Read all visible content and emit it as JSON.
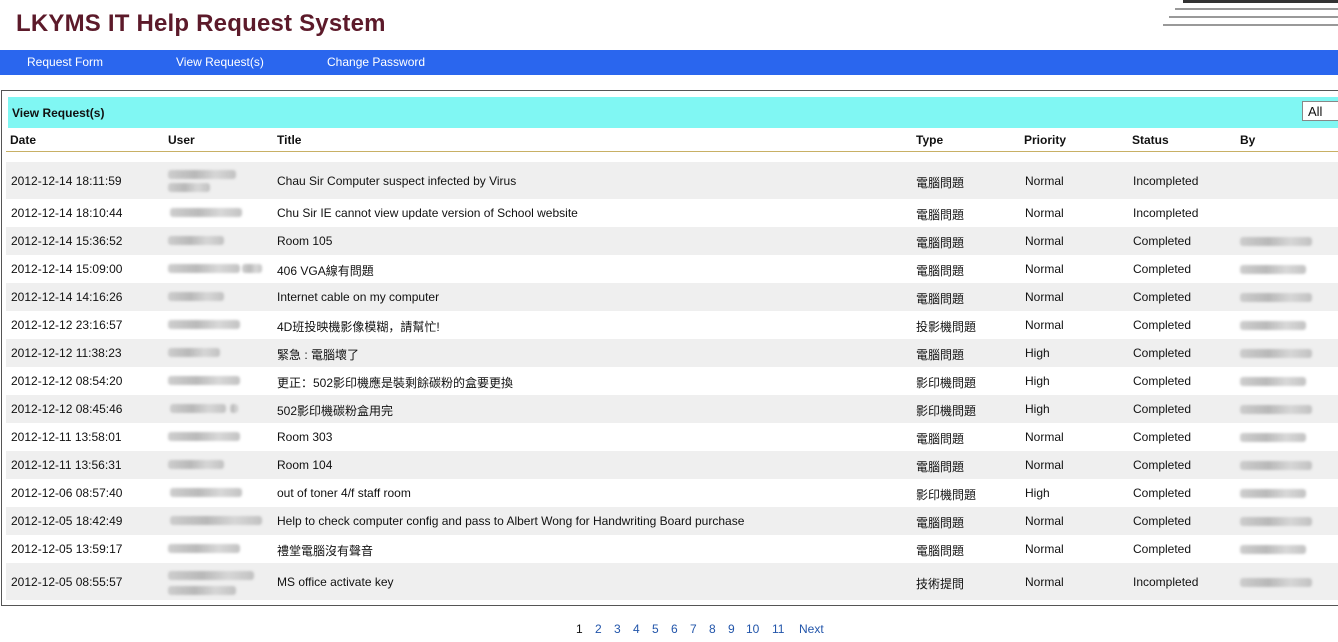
{
  "app": {
    "title": "LKYMS IT Help Request System"
  },
  "nav": {
    "items": [
      {
        "label": "Request Form"
      },
      {
        "label": "View Request(s)"
      },
      {
        "label": "Change Password"
      }
    ]
  },
  "panel": {
    "title": "View Request(s)",
    "filter_value": "All"
  },
  "table": {
    "headers": {
      "date": "Date",
      "user": "User",
      "title": "Title",
      "type": "Type",
      "priority": "Priority",
      "status": "Status",
      "by": "By"
    },
    "rows": [
      {
        "date": "2012-12-14 18:11:59",
        "title": "Chau Sir Computer suspect infected by Virus",
        "type": "電腦問題",
        "priority": "Normal",
        "status": "Incompleted",
        "by_redacted": false
      },
      {
        "date": "2012-12-14 18:10:44",
        "title": "Chu Sir IE cannot view update version of School website",
        "type": "電腦問題",
        "priority": "Normal",
        "status": "Incompleted",
        "by_redacted": false
      },
      {
        "date": "2012-12-14 15:36:52",
        "title": "Room 105",
        "type": "電腦問題",
        "priority": "Normal",
        "status": "Completed",
        "by_redacted": true
      },
      {
        "date": "2012-12-14 15:09:00",
        "title": "406 VGA線有問題",
        "type": "電腦問題",
        "priority": "Normal",
        "status": "Completed",
        "by_redacted": true
      },
      {
        "date": "2012-12-14 14:16:26",
        "title": "Internet cable on my computer",
        "type": "電腦問題",
        "priority": "Normal",
        "status": "Completed",
        "by_redacted": true
      },
      {
        "date": "2012-12-12 23:16:57",
        "title": "4D班投映機影像模糊，請幫忙!",
        "type": "投影機問題",
        "priority": "Normal",
        "status": "Completed",
        "by_redacted": true
      },
      {
        "date": "2012-12-12 11:38:23",
        "title": "緊急 : 電腦壞了",
        "type": "電腦問題",
        "priority": "High",
        "status": "Completed",
        "by_redacted": true
      },
      {
        "date": "2012-12-12 08:54:20",
        "title": "更正：502影印機應是裝剩餘碳粉的盒要更換",
        "type": "影印機問題",
        "priority": "High",
        "status": "Completed",
        "by_redacted": true
      },
      {
        "date": "2012-12-12 08:45:46",
        "title": "502影印機碳粉盒用完",
        "type": "影印機問題",
        "priority": "High",
        "status": "Completed",
        "by_redacted": true
      },
      {
        "date": "2012-12-11 13:58:01",
        "title": "Room 303",
        "type": "電腦問題",
        "priority": "Normal",
        "status": "Completed",
        "by_redacted": true
      },
      {
        "date": "2012-12-11 13:56:31",
        "title": "Room 104",
        "type": "電腦問題",
        "priority": "Normal",
        "status": "Completed",
        "by_redacted": true
      },
      {
        "date": "2012-12-06 08:57:40",
        "title": "out of toner 4/f staff room",
        "type": "影印機問題",
        "priority": "High",
        "status": "Completed",
        "by_redacted": true
      },
      {
        "date": "2012-12-05 18:42:49",
        "title": "Help to check computer config and pass to Albert Wong for Handwriting Board purchase",
        "type": "電腦問題",
        "priority": "Normal",
        "status": "Completed",
        "by_redacted": true
      },
      {
        "date": "2012-12-05 13:59:17",
        "title": "禮堂電腦沒有聲音",
        "type": "電腦問題",
        "priority": "Normal",
        "status": "Completed",
        "by_redacted": true
      },
      {
        "date": "2012-12-05 08:55:57",
        "title": "MS office activate key",
        "type": "技術提問",
        "priority": "Normal",
        "status": "Incompleted",
        "by_redacted": true
      }
    ]
  },
  "pagination": {
    "current": "1",
    "pages": [
      "1",
      "2",
      "3",
      "4",
      "5",
      "6",
      "7",
      "8",
      "9",
      "10",
      "11"
    ],
    "next_label": "Next"
  }
}
